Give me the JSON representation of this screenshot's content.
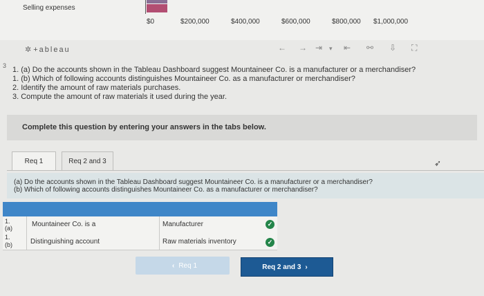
{
  "chart": {
    "label": "Selling expenses",
    "ticks": [
      "$0",
      "$200,000",
      "$400,000",
      "$600,000",
      "$800,000",
      "$1,000,000"
    ]
  },
  "toolbar": {
    "logo": "+ableau",
    "icons": [
      "undo-icon",
      "redo-icon",
      "revert-icon",
      "refresh-icon",
      "reset-icon",
      "share-icon",
      "download-icon",
      "fullscreen-icon"
    ]
  },
  "questions": [
    "1. (a) Do the accounts shown in the Tableau Dashboard suggest Mountaineer Co. is a manufacturer or a merchandiser?",
    "1. (b) Which of following accounts distinguishes Mountaineer Co. as a manufacturer or merchandiser?",
    "2. Identify the amount of raw materials purchases.",
    "3. Compute the amount of raw materials it used during the year."
  ],
  "instruction": "Complete this question by entering your answers in the tabs below.",
  "tabs": [
    "Req 1",
    "Req 2 and 3"
  ],
  "panel": {
    "line_a": "(a) Do the accounts shown in the Tableau Dashboard suggest Mountaineer Co. is a manufacturer or a merchandiser?",
    "line_b": "(b) Which of following accounts distinguishes Mountaineer Co. as a manufacturer or merchandiser?"
  },
  "table": {
    "rows": [
      {
        "idx": "1.",
        "sub": "(a)",
        "label": "Mountaineer Co. is a",
        "answer": "Manufacturer",
        "status": "correct"
      },
      {
        "idx": "1.",
        "sub": "(b)",
        "label": "Distinguishing account",
        "answer": "Raw materials inventory",
        "status": "correct"
      }
    ]
  },
  "nav": {
    "prev": "Req 1",
    "next": "Req 2 and 3"
  },
  "colors": {
    "header_blue": "#3f86c8",
    "next_button": "#1d5a94",
    "check_green": "#24854a"
  }
}
